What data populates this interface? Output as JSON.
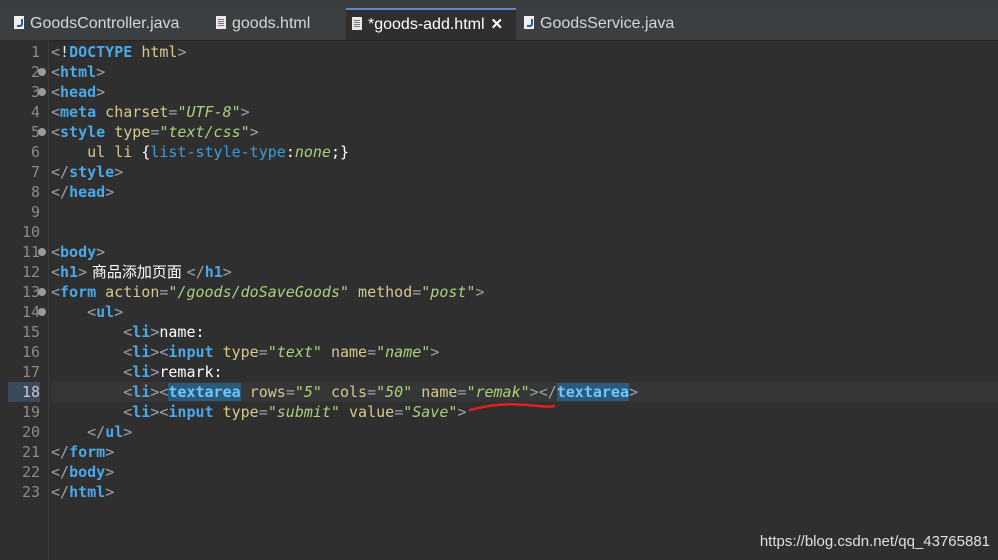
{
  "tabs": [
    {
      "label": "GoodsController.java",
      "icon": "java-file-icon",
      "active": false
    },
    {
      "label": "goods.html",
      "icon": "html-file-icon",
      "active": false
    },
    {
      "label": "*goods-add.html",
      "icon": "html-file-icon",
      "active": true
    },
    {
      "label": "GoodsService.java",
      "icon": "java-file-icon",
      "active": false
    }
  ],
  "tab_close_glyph": "✕",
  "line_numbers": [
    "1",
    "2",
    "3",
    "4",
    "5",
    "6",
    "7",
    "8",
    "9",
    "10",
    "11",
    "12",
    "13",
    "14",
    "15",
    "16",
    "17",
    "18",
    "19",
    "20",
    "21",
    "22",
    "23"
  ],
  "current_line": "18",
  "code": {
    "l1": {
      "lt": "<",
      "bang": "!",
      "doctype": "DOCTYPE",
      "sp": " ",
      "html": "html",
      "gt": ">"
    },
    "l2": {
      "open": "<",
      "tag": "html",
      "close": ">"
    },
    "l3": {
      "open": "<",
      "tag": "head",
      "close": ">"
    },
    "l4": {
      "open": "<",
      "tag": "meta",
      "attr": " charset",
      "eq": "=",
      "val": "\"UTF-8\"",
      "close": ">"
    },
    "l5": {
      "open": "<",
      "tag": "style",
      "attr": " type",
      "eq": "=",
      "val": "\"text/css\"",
      "close": ">"
    },
    "l6": {
      "indent": "    ",
      "sel": "ul li ",
      "brace_open": "{",
      "prop": "list-style-type",
      "colon": ":",
      "value": "none",
      "end": ";}"
    },
    "l7": {
      "open": "</",
      "tag": "style",
      "close": ">"
    },
    "l8": {
      "open": "</",
      "tag": "head",
      "close": ">"
    },
    "l11": {
      "open": "<",
      "tag": "body",
      "close": ">"
    },
    "l12": {
      "open": "<",
      "tag": "h1",
      "close": ">",
      "text": " 商品添加页面 ",
      "open2": "</",
      "tag2": "h1",
      "close2": ">"
    },
    "l13": {
      "open": "<",
      "tag": "form",
      "attr1": " action",
      "eq1": "=",
      "val1": "\"/goods/doSaveGoods\"",
      "attr2": " method",
      "eq2": "=",
      "val2": "\"post\"",
      "close": ">"
    },
    "l14": {
      "indent": "    ",
      "open": "<",
      "tag": "ul",
      "close": ">"
    },
    "l15": {
      "indent": "        ",
      "open": "<",
      "tag": "li",
      "close": ">",
      "text": "name:"
    },
    "l16": {
      "indent": "        ",
      "open": "<",
      "tag": "li",
      "close": ">",
      "open2": "<",
      "tag2": "input",
      "attr1": " type",
      "eq1": "=",
      "val1": "\"text\"",
      "attr2": " name",
      "eq2": "=",
      "val2": "\"name\"",
      "close2": ">"
    },
    "l17": {
      "indent": "        ",
      "open": "<",
      "tag": "li",
      "close": ">",
      "text": "remark:"
    },
    "l18": {
      "indent": "        ",
      "open": "<",
      "tag": "li",
      "close": ">",
      "open2": "<",
      "tag2": "textarea",
      "attr1": " rows",
      "eq1": "=",
      "val1": "\"5\"",
      "attr2": " cols",
      "eq2": "=",
      "val2": "\"50\"",
      "attr3": " name",
      "eq3": "=",
      "val3": "\"remak\"",
      "close2": ">",
      "open3": "</",
      "tag3": "textarea",
      "close3": ">"
    },
    "l19": {
      "indent": "        ",
      "open": "<",
      "tag": "li",
      "close": ">",
      "open2": "<",
      "tag2": "input",
      "attr1": " type",
      "eq1": "=",
      "val1": "\"submit\"",
      "attr2": " value",
      "eq2": "=",
      "val2": "\"Save\"",
      "close2": ">"
    },
    "l20": {
      "indent": "    ",
      "open": "</",
      "tag": "ul",
      "close": ">"
    },
    "l21": {
      "open": "</",
      "tag": "form",
      "close": ">"
    },
    "l22": {
      "open": "</",
      "tag": "body",
      "close": ">"
    },
    "l23": {
      "open": "</",
      "tag": "html",
      "close": ">"
    }
  },
  "watermark": "https://blog.csdn.net/qq_43765881",
  "colors": {
    "background": "#2f2f2f",
    "tag": "#4aa8e8",
    "attribute": "#d5c98c",
    "string": "#a9d17d",
    "annotation": "#e02020"
  }
}
